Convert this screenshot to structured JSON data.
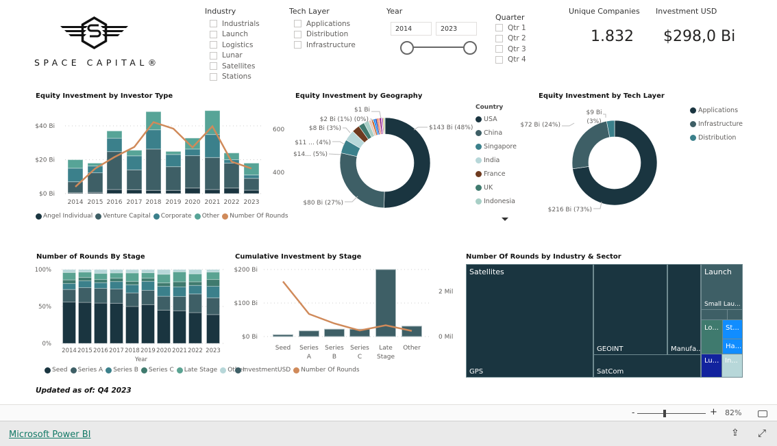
{
  "logo": {
    "text": "SPACE CAPITAL®"
  },
  "filters": {
    "industry": {
      "title": "Industry",
      "items": [
        "Industrials",
        "Launch",
        "Logistics",
        "Lunar",
        "Satellites",
        "Stations"
      ]
    },
    "tech_layer": {
      "title": "Tech Layer",
      "items": [
        "Applications",
        "Distribution",
        "Infrastructure"
      ]
    },
    "year": {
      "title": "Year",
      "from": "2014",
      "to": "2023"
    },
    "quarter": {
      "title": "Quarter",
      "items": [
        "Qtr 1",
        "Qtr 2",
        "Qtr 3",
        "Qtr 4"
      ]
    }
  },
  "kpis": {
    "unique_companies": {
      "label": "Unique Companies",
      "value": "1.832"
    },
    "investment": {
      "label": "Investment USD",
      "value": "$298,0 Bi"
    }
  },
  "colors": {
    "dark": "#1a3540",
    "vc": "#3e5f66",
    "corp": "#3b808b",
    "other": "#57a497",
    "rounds": "#d08a5a",
    "seriesC": "#3f7a6e",
    "stageOther": "#b7d7d9"
  },
  "chart_data": [
    {
      "type": "bar",
      "title": "Equity Investment by Investor Type",
      "stacked": true,
      "categories": [
        "2014",
        "2015",
        "2016",
        "2017",
        "2018",
        "2019",
        "2020",
        "2021",
        "2022",
        "2023"
      ],
      "yticks": [
        "$0 Bi",
        "$20 Bi",
        "$40 Bi"
      ],
      "y2ticks": [
        "400",
        "600"
      ],
      "ylim": [
        0,
        40
      ],
      "series": [
        {
          "name": "Angel Individual",
          "color": "#1a3540",
          "values": [
            0.5,
            0.7,
            2.4,
            2.3,
            1.9,
            1.9,
            3.3,
            2.4,
            3.3,
            2
          ]
        },
        {
          "name": "Venture Capital",
          "color": "#3e5f66",
          "values": [
            6.5,
            11.6,
            22.4,
            11.7,
            24.4,
            14,
            19.1,
            18.9,
            14.7,
            7
          ]
        },
        {
          "name": "Corporate",
          "color": "#3b808b",
          "values": [
            8,
            4,
            7.9,
            8.3,
            11.4,
            7.2,
            3.9,
            13.6,
            2,
            2
          ]
        },
        {
          "name": "Other",
          "color": "#57a497",
          "values": [
            5,
            1.7,
            4.3,
            3.3,
            10.7,
            1.8,
            6.5,
            14.1,
            4,
            7
          ]
        },
        {
          "name": "Number Of Rounds",
          "color": "#d08a5a",
          "type": "line",
          "axis": "right",
          "values": [
            333,
            418,
            471,
            518,
            633,
            603,
            516,
            614,
            450,
            418
          ]
        }
      ]
    },
    {
      "type": "pie",
      "donut": true,
      "title": "Equity Investment by Geography",
      "legend_title": "Country",
      "slices": [
        {
          "name": "USA",
          "value": 143,
          "color": "#1a3540",
          "label": "$143 Bi (48%)"
        },
        {
          "name": "China",
          "value": 80,
          "color": "#3e5f66",
          "label": "$80 Bi (27%)"
        },
        {
          "name": "Singapore",
          "value": 14,
          "color": "#3b808b",
          "label": "$14... (5%)"
        },
        {
          "name": "India",
          "value": 11,
          "color": "#b7d7d9",
          "label": "$11 ... (4%)"
        },
        {
          "name": "France",
          "value": 8,
          "color": "#6e3a1f",
          "label": "$8 Bi (3%)"
        },
        {
          "name": "UK",
          "value": 6,
          "color": "#3f7a6e"
        },
        {
          "name": "Indonesia",
          "value": 5,
          "color": "#a8cfc6"
        },
        {
          "value": 3,
          "color": "#e6c9bd"
        },
        {
          "value": 2,
          "color": "#c45a1c",
          "label": "$2 Bi (1%) (0%)"
        },
        {
          "value": 2,
          "color": "#118dff"
        },
        {
          "value": 1.5,
          "color": "#12239e"
        },
        {
          "value": 1.5,
          "color": "#e66c37"
        },
        {
          "value": 1.5,
          "color": "#ee8a8a"
        },
        {
          "value": 1.5,
          "color": "#6b007b"
        },
        {
          "value": 1,
          "color": "#e044a7",
          "label": "$1 Bi"
        },
        {
          "value": 1,
          "color": "#744ec2"
        },
        {
          "value": 1,
          "color": "#d9b300"
        },
        {
          "value": 1,
          "color": "#a0d1c1"
        }
      ]
    },
    {
      "type": "pie",
      "donut": true,
      "title": "Equity Investment by Tech Layer",
      "slices": [
        {
          "name": "Applications",
          "value": 216,
          "color": "#1a3540",
          "label": "$216 Bi (73%)"
        },
        {
          "name": "Infrastructure",
          "value": 72,
          "color": "#3e5f66",
          "label": "$72 Bi (24%)"
        },
        {
          "name": "Distribution",
          "value": 9,
          "color": "#3b808b",
          "label": "$9 Bi (3%)"
        }
      ]
    },
    {
      "type": "bar",
      "title": "Number of Rounds By Stage",
      "stacked": true,
      "percent": true,
      "xlabel": "Year",
      "categories": [
        "2014",
        "2015",
        "2016",
        "2017",
        "2018",
        "2019",
        "2020",
        "2021",
        "2022",
        "2023"
      ],
      "yticks": [
        "0%",
        "50%",
        "100%"
      ],
      "series": [
        {
          "name": "Seed",
          "color": "#1a3540",
          "values": [
            56,
            55.5,
            54.6,
            54.3,
            50,
            52.5,
            45,
            44.2,
            41.7,
            39
          ]
        },
        {
          "name": "Series A",
          "color": "#3e5f66",
          "values": [
            17,
            20,
            19.9,
            19.3,
            18.4,
            19.3,
            18.8,
            19.3,
            25.2,
            22.7
          ]
        },
        {
          "name": "Series B",
          "color": "#3b808b",
          "values": [
            8,
            9.2,
            7.7,
            10.1,
            11,
            12.2,
            13.5,
            12.9,
            11.6,
            15.6
          ]
        },
        {
          "name": "Series C",
          "color": "#3f7a6e",
          "values": [
            5,
            4.6,
            4.3,
            4.6,
            4.6,
            4.3,
            4.6,
            7,
            4.9,
            9.2
          ]
        },
        {
          "name": "Late Stage",
          "color": "#5aa392",
          "values": [
            10,
            7.3,
            8.3,
            7.1,
            11.4,
            7.4,
            11.7,
            13.5,
            10.8,
            10.1
          ]
        },
        {
          "name": "Other",
          "color": "#b7d7d9",
          "values": [
            4,
            3.4,
            5.2,
            4.6,
            4.6,
            4.3,
            6.4,
            3.1,
            5.8,
            3.4
          ]
        }
      ]
    },
    {
      "type": "bar",
      "title": "Cumulative Investment by Stage",
      "categories": [
        [
          "Seed"
        ],
        [
          "Series",
          "A"
        ],
        [
          "Series",
          "B"
        ],
        [
          "Series",
          "C"
        ],
        [
          "Late",
          "Stage"
        ],
        [
          "Other"
        ]
      ],
      "yticks": [
        "$0 Bi",
        "$100 Bi",
        "$200 Bi"
      ],
      "y2ticks": [
        "0 Mil",
        "2 Mil"
      ],
      "ylim": [
        0,
        200
      ],
      "series": [
        {
          "name": "InvestmentUSD",
          "color": "#3e5f66",
          "values": [
            5.5,
            17,
            22,
            22,
            200,
            31
          ]
        },
        {
          "name": "Number Of Rounds",
          "color": "#d08a5a",
          "type": "line",
          "axis": "right",
          "unit": "Mil",
          "values": [
            2.44,
            1.0,
            0.58,
            0.27,
            0.5,
            0.25
          ]
        }
      ]
    },
    {
      "type": "treemap",
      "title": "Number Of Rounds by Industry & Sector",
      "groups": [
        "Satellites",
        "Launch"
      ],
      "cells": [
        "GPS",
        "GEOINT",
        "Manufa...",
        "SatCom",
        "Small Lau...",
        "Lo...",
        "St...",
        "Ha...",
        "Lu...",
        "In..."
      ]
    }
  ],
  "updated": "Updated as of: Q4 2023",
  "footer": {
    "zoom": "82%",
    "minus": "-",
    "plus": "+",
    "link": "Microsoft Power BI"
  }
}
